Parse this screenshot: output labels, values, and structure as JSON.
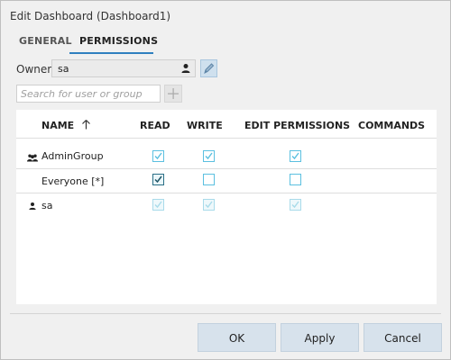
{
  "dialog": {
    "title": "Edit Dashboard (Dashboard1)"
  },
  "tabs": [
    {
      "label": "GENERAL",
      "active": false
    },
    {
      "label": "PERMISSIONS",
      "active": true
    }
  ],
  "owner": {
    "label": "Owner",
    "value": "sa",
    "icon": "user-icon",
    "edit_icon": "pencil-icon"
  },
  "search": {
    "placeholder": "Search for user or group",
    "add_icon": "plus-icon"
  },
  "grid": {
    "columns": [
      "NAME",
      "READ",
      "WRITE",
      "EDIT PERMISSIONS",
      "COMMANDS"
    ],
    "sort_icon": "arrow-up-icon",
    "rows": [
      {
        "name": "AdminGroup",
        "icon": "group-icon",
        "read": true,
        "write": true,
        "edit_permissions": true
      },
      {
        "name": "Everyone [*]",
        "icon": "",
        "read": true,
        "write": false,
        "edit_permissions": false
      },
      {
        "name": "sa",
        "icon": "user-icon",
        "read": true,
        "write": true,
        "edit_permissions": true,
        "disabled": true
      }
    ]
  },
  "buttons": {
    "ok": "OK",
    "apply": "Apply",
    "cancel": "Cancel"
  },
  "colors": {
    "accent": "#2f7fbf",
    "checkbox": "#5bc0e0",
    "checkbox_dark": "#2a6f86",
    "button_bg": "#d7e2ec"
  }
}
